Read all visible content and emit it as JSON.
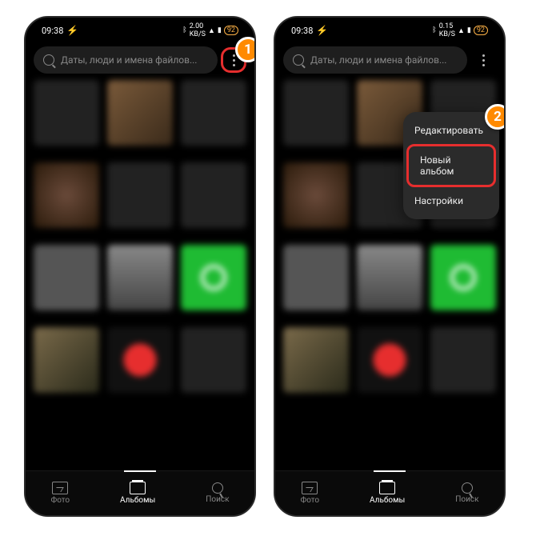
{
  "statusbar": {
    "time": "09:38",
    "speed": "2.00",
    "speed2": "0.15",
    "speed_unit": "KB/S",
    "battery": "92"
  },
  "search": {
    "placeholder": "Даты, люди и имена файлов..."
  },
  "tabs": {
    "photos": "Фото",
    "albums": "Альбомы",
    "search": "Поиск"
  },
  "dropdown": {
    "edit": "Редактировать",
    "new_album": "Новый альбом",
    "settings": "Настройки"
  },
  "annotations": {
    "step1": "1",
    "step2": "2"
  }
}
